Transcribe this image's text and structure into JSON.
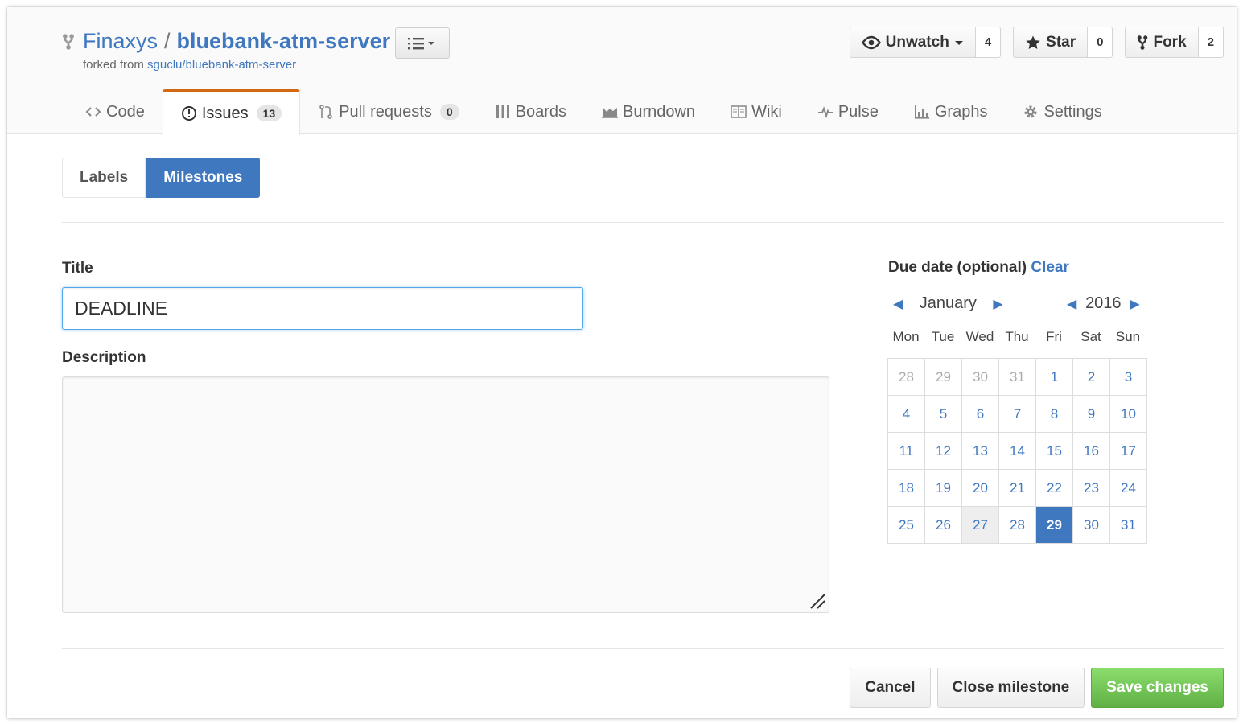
{
  "repo": {
    "owner": "Finaxys",
    "separator": "/",
    "name": "bluebank-atm-server",
    "forked_prefix": "forked from",
    "forked_source": "sguclu/bluebank-atm-server"
  },
  "actions": {
    "watch": {
      "label": "Unwatch",
      "count": "4"
    },
    "star": {
      "label": "Star",
      "count": "0"
    },
    "fork": {
      "label": "Fork",
      "count": "2"
    }
  },
  "tabs": [
    {
      "label": "Code",
      "icon": "code-icon"
    },
    {
      "label": "Issues",
      "icon": "issue-icon",
      "count": "13"
    },
    {
      "label": "Pull requests",
      "icon": "pull-request-icon",
      "count": "0"
    },
    {
      "label": "Boards",
      "icon": "boards-icon"
    },
    {
      "label": "Burndown",
      "icon": "burndown-icon"
    },
    {
      "label": "Wiki",
      "icon": "wiki-icon"
    },
    {
      "label": "Pulse",
      "icon": "pulse-icon"
    },
    {
      "label": "Graphs",
      "icon": "graphs-icon"
    },
    {
      "label": "Settings",
      "icon": "gear-icon"
    }
  ],
  "subnav": {
    "labels": "Labels",
    "milestones": "Milestones"
  },
  "form": {
    "title_label": "Title",
    "title_value": "DEADLINE",
    "description_label": "Description",
    "description_value": ""
  },
  "due": {
    "label": "Due date (optional)",
    "clear": "Clear",
    "month": "January",
    "year": "2016",
    "weekdays": [
      "Mon",
      "Tue",
      "Wed",
      "Thu",
      "Fri",
      "Sat",
      "Sun"
    ],
    "weeks": [
      [
        "28",
        "29",
        "30",
        "31",
        "1",
        "2",
        "3"
      ],
      [
        "4",
        "5",
        "6",
        "7",
        "8",
        "9",
        "10"
      ],
      [
        "11",
        "12",
        "13",
        "14",
        "15",
        "16",
        "17"
      ],
      [
        "18",
        "19",
        "20",
        "21",
        "22",
        "23",
        "24"
      ],
      [
        "25",
        "26",
        "27",
        "28",
        "29",
        "30",
        "31"
      ]
    ],
    "selected_day": "29",
    "today_day": "27"
  },
  "buttons": {
    "cancel": "Cancel",
    "close": "Close milestone",
    "save": "Save changes"
  },
  "colors": {
    "accent": "#4078c0",
    "tab_highlight": "#d26911",
    "save_green": "#6cc644"
  }
}
